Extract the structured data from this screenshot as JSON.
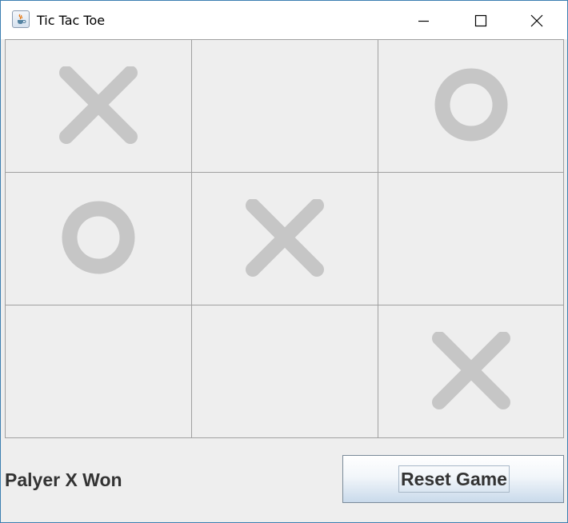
{
  "window": {
    "title": "Tic Tac Toe",
    "icon": "java-cup-icon"
  },
  "title_buttons": [
    "minimize-icon",
    "maximize-icon",
    "close-icon"
  ],
  "board": {
    "cells": [
      "X",
      "",
      "O",
      "O",
      "X",
      "",
      "",
      "",
      "X"
    ],
    "mark_color": "#c6c6c6",
    "cell_background": "#eeeeee",
    "grid_color": "#a0a0a0"
  },
  "status": {
    "text": "Palyer X Won"
  },
  "controls": {
    "reset_label": "Reset Game"
  }
}
